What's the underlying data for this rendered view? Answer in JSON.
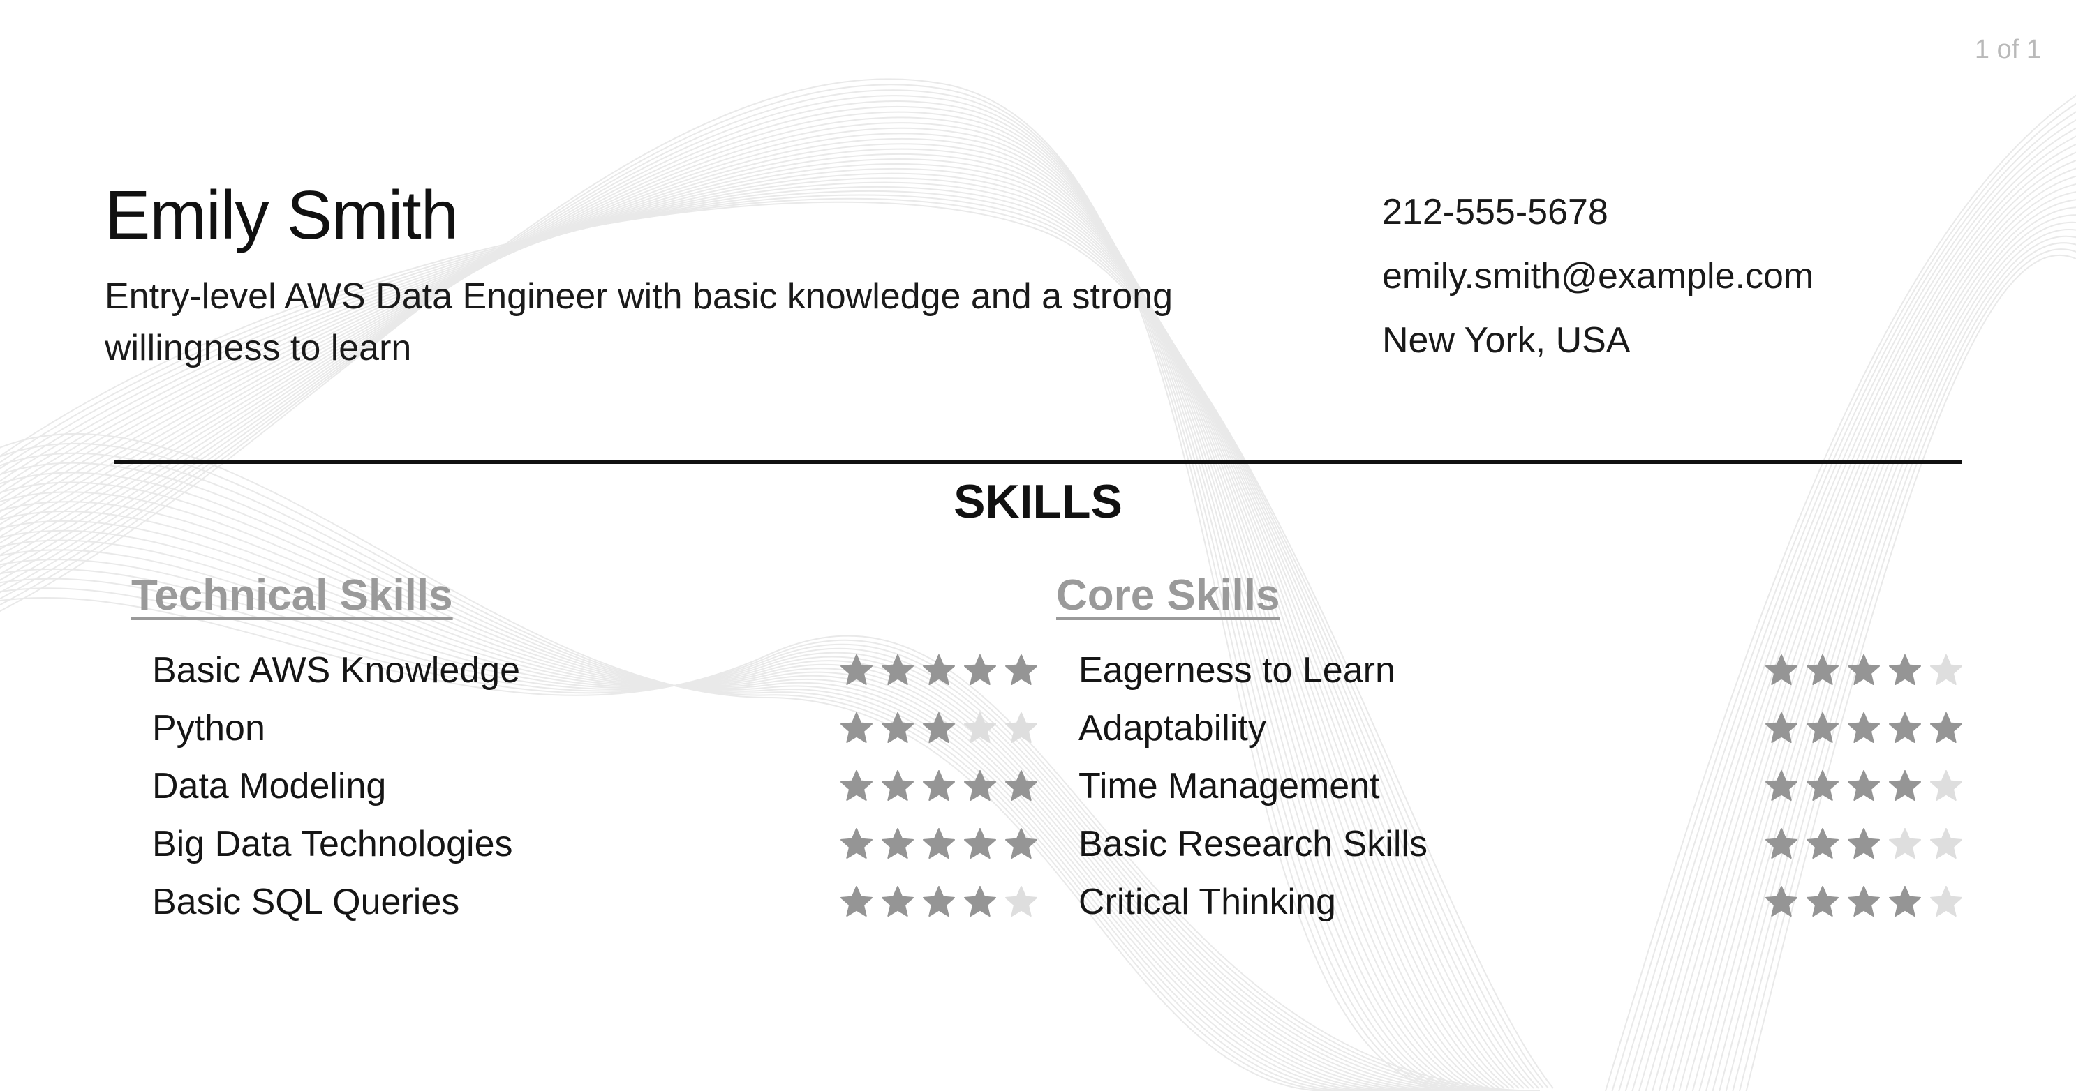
{
  "page_indicator": "1 of 1",
  "header": {
    "name": "Emily Smith",
    "tagline": "Entry-level AWS Data Engineer with basic knowledge and a strong willingness to learn"
  },
  "contact": {
    "phone": "212-555-5678",
    "email": "emily.smith@example.com",
    "location": "New York, USA"
  },
  "skills": {
    "title": "SKILLS",
    "max_rating": 5,
    "colors": {
      "star_filled": "#959595",
      "star_empty": "#dedede",
      "subheading": "#9a9a9a"
    },
    "technical": {
      "heading": "Technical Skills",
      "items": [
        {
          "label": "Basic AWS Knowledge",
          "rating": 5
        },
        {
          "label": "Python",
          "rating": 3
        },
        {
          "label": "Data Modeling",
          "rating": 5
        },
        {
          "label": "Big Data Technologies",
          "rating": 5
        },
        {
          "label": "Basic SQL Queries",
          "rating": 4
        }
      ]
    },
    "core": {
      "heading": "Core Skills",
      "items": [
        {
          "label": "Eagerness to Learn",
          "rating": 4
        },
        {
          "label": "Adaptability",
          "rating": 5
        },
        {
          "label": "Time Management",
          "rating": 4
        },
        {
          "label": "Basic Research Skills",
          "rating": 3
        },
        {
          "label": "Critical Thinking",
          "rating": 4
        }
      ]
    }
  }
}
